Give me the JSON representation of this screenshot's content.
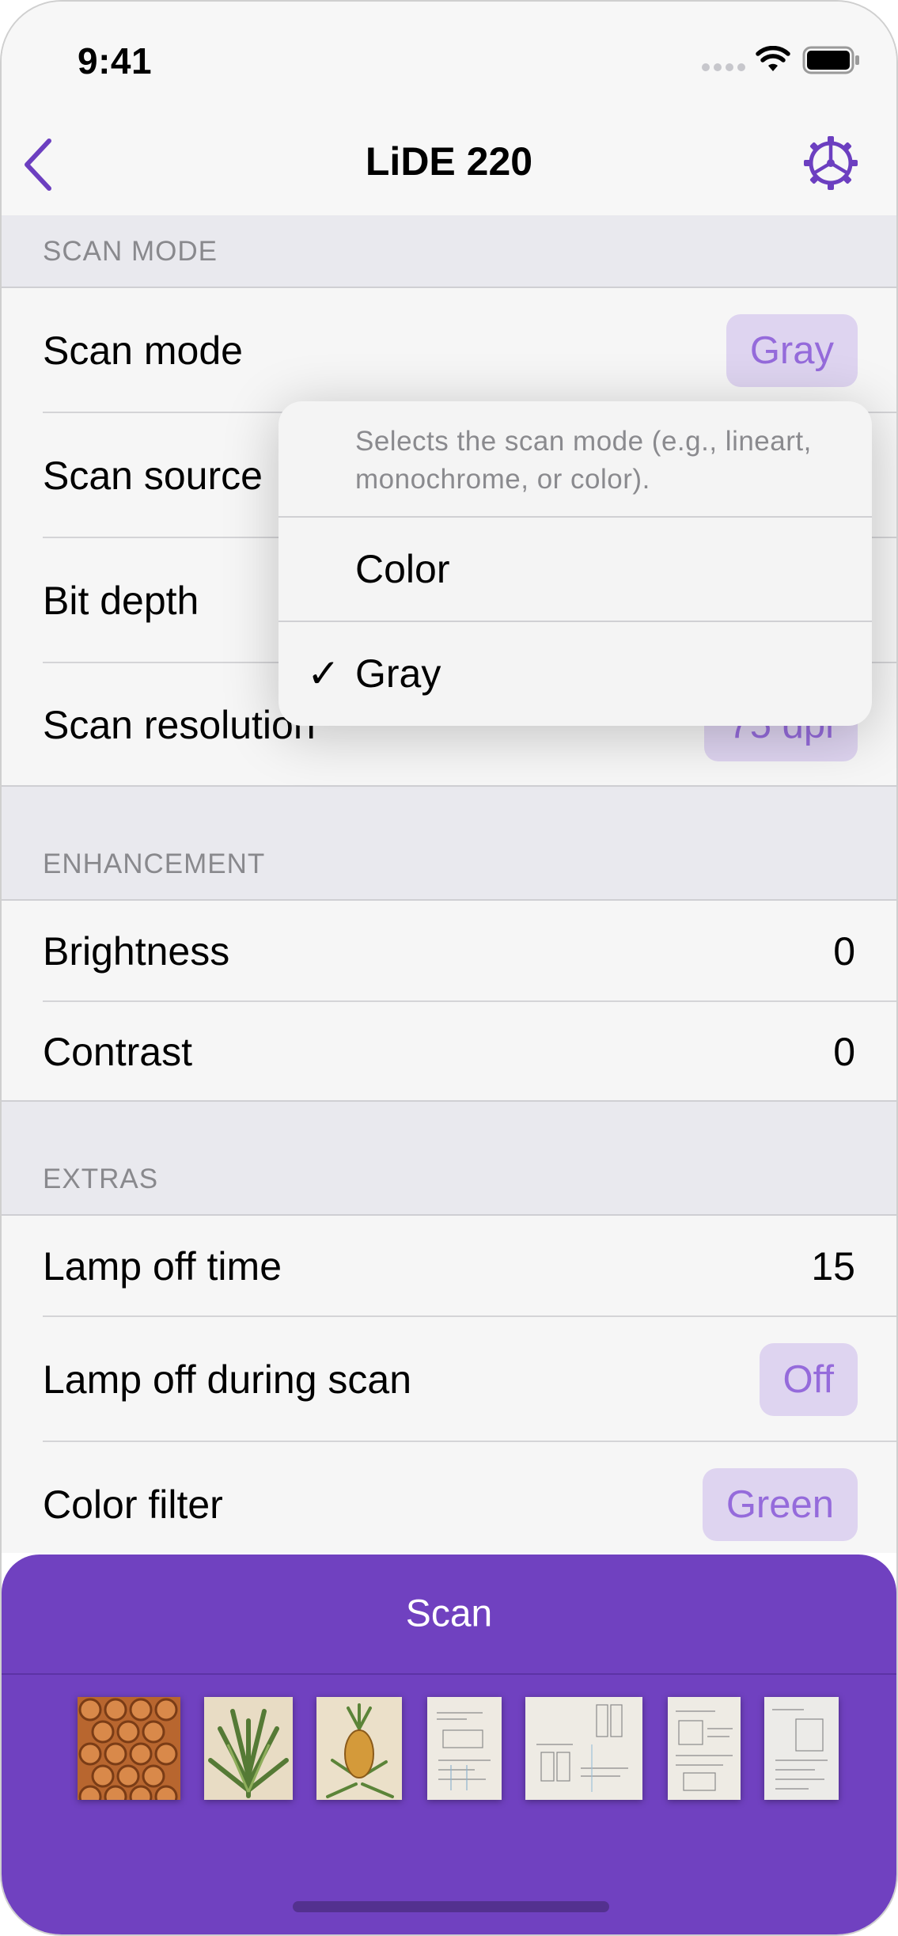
{
  "status_bar": {
    "time": "9:41"
  },
  "nav": {
    "title": "LiDE 220"
  },
  "sections": {
    "scan_mode": {
      "header": "SCAN MODE",
      "rows": [
        {
          "label": "Scan mode",
          "value": "Gray"
        },
        {
          "label": "Scan source"
        },
        {
          "label": "Bit depth"
        },
        {
          "label": "Scan resolution",
          "value": "75 dpi"
        }
      ]
    },
    "enhancement": {
      "header": "ENHANCEMENT",
      "rows": [
        {
          "label": "Brightness",
          "value": "0"
        },
        {
          "label": "Contrast",
          "value": "0"
        }
      ]
    },
    "extras": {
      "header": "EXTRAS",
      "rows": [
        {
          "label": "Lamp off time",
          "value": "15"
        },
        {
          "label": "Lamp off during scan",
          "value": "Off"
        },
        {
          "label": "Color filter",
          "value": "Green"
        }
      ]
    }
  },
  "menu": {
    "description": "Selects the scan mode (e.g., lineart, monochrome, or color).",
    "options": [
      {
        "label": "Color",
        "selected": false
      },
      {
        "label": "Gray",
        "selected": true
      }
    ],
    "check_glyph": "✓"
  },
  "scan_panel": {
    "button_label": "Scan",
    "thumbnails": [
      "pineapple-skin-thumbnail",
      "pineapple-top-thumbnail",
      "pineapple-plant-thumbnail",
      "sketch-page-1-thumbnail",
      "sketch-page-2-thumbnail",
      "sketch-page-3-thumbnail",
      "sketch-page-4-thumbnail"
    ]
  },
  "colors": {
    "accent": "#7041c0",
    "tint": "#6c3fc0",
    "pill_bg": "#e7dcf9",
    "pill_text": "#9b6fe3"
  }
}
